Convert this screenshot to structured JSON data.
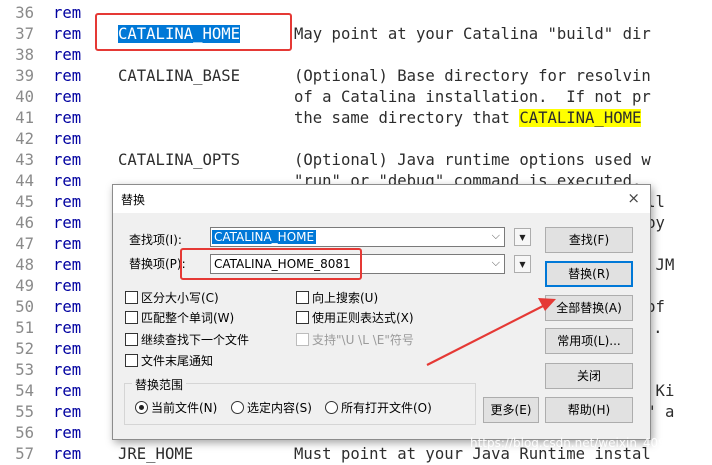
{
  "editor": {
    "lines": [
      {
        "n": "36",
        "kw": "rem",
        "c1": "",
        "c2": ""
      },
      {
        "n": "37",
        "kw": "rem",
        "c1": "CATALINA_HOME",
        "c2": "May point at your Catalina \"build\" dir"
      },
      {
        "n": "38",
        "kw": "rem",
        "c1": "",
        "c2": ""
      },
      {
        "n": "39",
        "kw": "rem",
        "c1": "CATALINA_BASE",
        "c2": "(Optional) Base directory for resolvin"
      },
      {
        "n": "40",
        "kw": "rem",
        "c1": "",
        "c2": "of a Catalina installation.  If not pr"
      },
      {
        "n": "41",
        "kw": "rem",
        "c1": "",
        "c2": "the same directory that "
      },
      {
        "n": "42",
        "kw": "rem",
        "c1": "",
        "c2": ""
      },
      {
        "n": "43",
        "kw": "rem",
        "c1": "CATALINA_OPTS",
        "c2": "(Optional) Java runtime options used w"
      },
      {
        "n": "44",
        "kw": "rem",
        "c1": "",
        "c2": "\"run\" or \"debug\" command is executed."
      },
      {
        "n": "45",
        "kw": "rem",
        "c1": "",
        "c2": "S all"
      },
      {
        "n": "46",
        "kw": "rem",
        "c1": "",
        "c2": "ot by"
      },
      {
        "n": "47",
        "kw": "rem",
        "c1": "",
        "c2": ""
      },
      {
        "n": "48",
        "kw": "rem",
        "c1": "",
        "c2": "ng, JM"
      },
      {
        "n": "49",
        "kw": "rem",
        "c1": "",
        "c2": ""
      },
      {
        "n": "50",
        "kw": "rem",
        "c1": "",
        "c2": "on of"
      },
      {
        "n": "51",
        "kw": "rem",
        "c1": "",
        "c2": "ir)."
      },
      {
        "n": "52",
        "kw": "rem",
        "c1": "",
        "c2": ""
      },
      {
        "n": "53",
        "kw": "rem",
        "c1": "",
        "c2": ""
      },
      {
        "n": "54",
        "kw": "rem",
        "c1": "",
        "c2": "ent Ki"
      },
      {
        "n": "55",
        "kw": "rem",
        "c1": "",
        "c2": "bug\" a"
      },
      {
        "n": "56",
        "kw": "rem",
        "c1": "",
        "c2": ""
      },
      {
        "n": "57",
        "kw": "rem",
        "c1": "JRE_HOME",
        "c2": "Must point at your Java Runtime instal"
      }
    ],
    "line41_highlight": "CATALINA_HOME"
  },
  "dialog": {
    "title": "替换",
    "find_label": "查找项(I):",
    "find_value": "CATALINA_HOME",
    "replace_label": "替换项(P):",
    "replace_value": "CATALINA_HOME_8081",
    "options": {
      "match_case": "区分大小写(C)",
      "whole_word": "匹配整个单词(W)",
      "continue_search": "继续查找下一个文件",
      "end_notify": "文件末尾通知",
      "search_up": "向上搜索(U)",
      "use_regex": "使用正则表达式(X)",
      "support_escape": "支持\"\\U \\L \\E\"符号"
    },
    "scope": {
      "label": "替换范围",
      "current": "当前文件(N)",
      "selection": "选定内容(S)",
      "all_open": "所有打开文件(O)"
    },
    "buttons": {
      "find": "查找(F)",
      "replace": "替换(R)",
      "replace_all": "全部替换(A)",
      "common": "常用项(L)...",
      "close": "关闭",
      "more": "更多(E)",
      "help": "帮助(H)"
    },
    "close_glyph": "×"
  },
  "watermark": "https://blog.csdn.net/weixin_40951668",
  "colors": {
    "annotation": "#e53935",
    "selection": "#0078d7",
    "highlight": "#ffff00",
    "keyword": "#0000a0"
  }
}
